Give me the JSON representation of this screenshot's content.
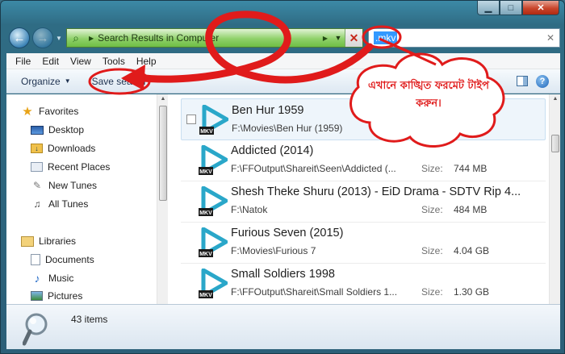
{
  "window": {
    "caption_buttons": [
      "minimize",
      "maximize",
      "close"
    ]
  },
  "navigation": {
    "address_text": "Search Results in Computer",
    "search_value": ".mkv"
  },
  "menu": [
    "File",
    "Edit",
    "View",
    "Tools",
    "Help"
  ],
  "toolbar": {
    "organize_label": "Organize",
    "save_search_label": "Save search"
  },
  "sidebar": {
    "favorites_label": "Favorites",
    "favorites": [
      {
        "label": "Desktop",
        "icon": "desktop-icon"
      },
      {
        "label": "Downloads",
        "icon": "downloads-icon"
      },
      {
        "label": "Recent Places",
        "icon": "recent-places-icon"
      },
      {
        "label": "New Tunes",
        "icon": "new-tunes-icon"
      },
      {
        "label": "All Tunes",
        "icon": "all-tunes-icon"
      }
    ],
    "libraries_label": "Libraries",
    "libraries": [
      {
        "label": "Documents",
        "icon": "documents-icon"
      },
      {
        "label": "Music",
        "icon": "music-icon"
      },
      {
        "label": "Pictures",
        "icon": "pictures-icon"
      }
    ]
  },
  "results": {
    "size_label": "Size:",
    "items": [
      {
        "title": "Ben Hur 1959",
        "path": "F:\\Movies\\Ben Hur (1959)",
        "size": "MB"
      },
      {
        "title": "Addicted (2014)",
        "path": "F:\\FFOutput\\Shareit\\Seen\\Addicted (...",
        "size": "744 MB"
      },
      {
        "title": "Shesh Theke Shuru (2013) - EiD Drama - SDTV Rip 4...",
        "path": "F:\\Natok",
        "size": "484 MB"
      },
      {
        "title": "Furious Seven (2015)",
        "path": "F:\\Movies\\Furious 7",
        "size": "4.04 GB"
      },
      {
        "title": "Small Soldiers 1998",
        "path": "F:\\FFOutput\\Shareit\\Small Soldiers 1...",
        "size": "1.30 GB"
      }
    ],
    "file_icon_label": "MKV"
  },
  "details": {
    "item_count": "43 items"
  },
  "annotation": {
    "callout_text": "এখানে কাঙ্খিত ফরমেট টাইপ করুন।",
    "color": "#e01b1b"
  }
}
